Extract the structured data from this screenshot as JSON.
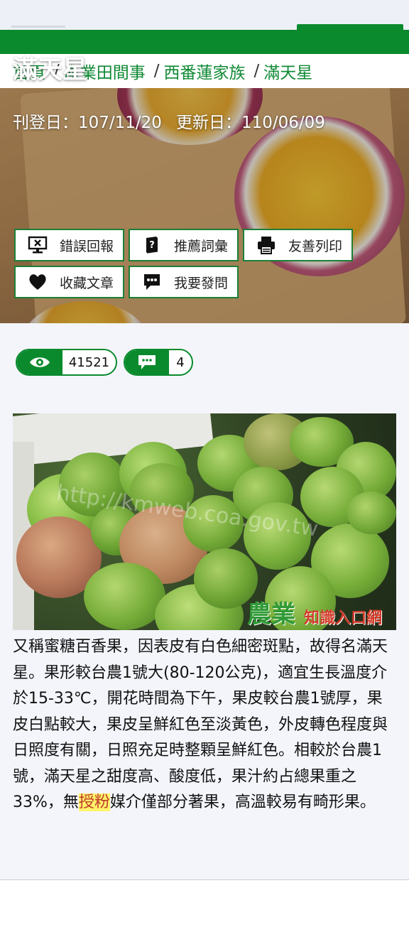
{
  "breadcrumb": {
    "items": [
      "首頁",
      "產業田間事",
      "西番蓮家族",
      "滿天星"
    ],
    "separator": "/"
  },
  "hero": {
    "title": "滿天星",
    "published_label": "刊登日：",
    "published_date": "107/11/20",
    "updated_label": "更新日：",
    "updated_date": "110/06/09"
  },
  "toolbar": {
    "report_error": "錯誤回報",
    "recommend_terms": "推薦詞彙",
    "print_friendly": "友善列印",
    "bookmark": "收藏文章",
    "ask_question": "我要發問"
  },
  "stats": {
    "views": "41521",
    "comments": "4"
  },
  "photo": {
    "watermark_logo": "農業",
    "watermark_text": "知識入口網",
    "watermark_url": "http://kmweb.coa.gov.tw"
  },
  "article": {
    "text_before": "又稱蜜糖百香果，因表皮有白色細密斑點，故得名滿天星。果形較台農1號大(80-120公克)，適宜生長溫度介於15-33℃，開花時間為下午，果皮較台農1號厚，果皮白點較大，果皮呈鮮紅色至淡黃色，外皮轉色程度與日照度有關，日照充足時整顆呈鮮紅色。相較於台農1號，滿天星之甜度高、酸度低，果汁約占總果重之33%，無",
    "highlight": "授粉",
    "text_after": "媒介僅部分著果，高溫較易有畸形果。"
  },
  "colors": {
    "brand_green": "#0a8a2d",
    "highlight_bg": "#fff36a"
  }
}
